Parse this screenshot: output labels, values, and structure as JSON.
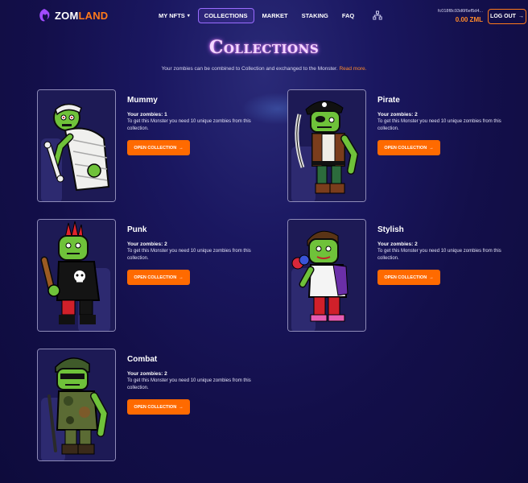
{
  "header": {
    "logo_prefix": "ZOM",
    "logo_suffix": "LAND",
    "nav": [
      {
        "label": "MY NFTS",
        "dropdown": true
      },
      {
        "label": "COLLECTIONS",
        "active": true
      },
      {
        "label": "MARKET"
      },
      {
        "label": "STAKING"
      },
      {
        "label": "FAQ"
      }
    ],
    "wallet_address": "fc018f8c93d6f6ef5d4...",
    "wallet_balance": "0.00 ZML",
    "logout_label": "LOG OUT"
  },
  "page": {
    "title": "Collections",
    "subtitle": "Your zombies can be combined to Collection and exchanged to the Monster.",
    "read_more": "Read more."
  },
  "collections": [
    {
      "name": "Mummy",
      "count": "Your zombies: 1",
      "desc": "To get this Monster you need 10 unique zombies from this collection.",
      "button": "OPEN COLLECTION"
    },
    {
      "name": "Pirate",
      "count": "Your zombies: 2",
      "desc": "To get this Monster you need 10 unique zombies from this collection.",
      "button": "OPEN COLLECTION"
    },
    {
      "name": "Punk",
      "count": "Your zombies: 2",
      "desc": "To get this Monster you need 10 unique zombies from this collection.",
      "button": "OPEN COLLECTION"
    },
    {
      "name": "Stylish",
      "count": "Your zombies: 2",
      "desc": "To get this Monster you need 10 unique zombies from this collection.",
      "button": "OPEN COLLECTION"
    },
    {
      "name": "Combat",
      "count": "Your zombies: 2",
      "desc": "To get this Monster you need 10 unique zombies from this collection.",
      "button": "OPEN COLLECTION"
    }
  ],
  "colors": {
    "accent": "#ff6a00",
    "zombie_skin": "#6fc23a",
    "panel_border": "#8e8bb8"
  }
}
